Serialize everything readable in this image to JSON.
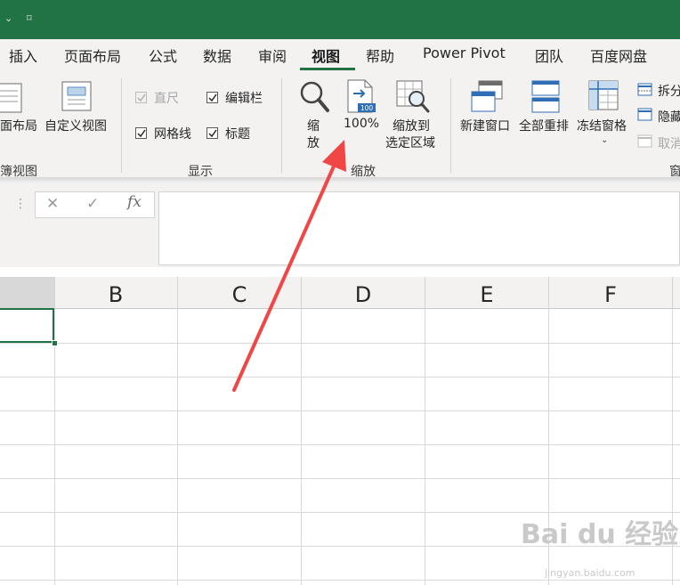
{
  "app": {
    "quick_access_glyph": "⌄",
    "quick_access_glyph2": "⌑"
  },
  "tabs": [
    {
      "label": "插入"
    },
    {
      "label": "页面布局"
    },
    {
      "label": "公式"
    },
    {
      "label": "数据"
    },
    {
      "label": "审阅"
    },
    {
      "label": "视图",
      "active": true
    },
    {
      "label": "帮助"
    },
    {
      "label": "Power Pivot"
    },
    {
      "label": "团队"
    },
    {
      "label": "百度网盘"
    }
  ],
  "ribbon": {
    "views_group": {
      "page_layout_label": "面布局",
      "custom_views_label": "自定义视图",
      "group_label": "簿视图"
    },
    "show_group": {
      "ruler_label": "直尺",
      "formula_bar_label": "编辑栏",
      "gridlines_label": "网格线",
      "headings_label": "标题",
      "group_label": "显示"
    },
    "zoom_group": {
      "zoom_label_1": "缩",
      "zoom_label_2": "放",
      "hundred_label": "100%",
      "hundred_icon_text": "100",
      "zoom_selection_label_1": "缩放到",
      "zoom_selection_label_2": "选定区域",
      "group_label": "缩放"
    },
    "window_group": {
      "new_window_label": "新建窗口",
      "arrange_all_label": "全部重排",
      "freeze_panes_label": "冻结窗格",
      "split_label": "拆分",
      "hide_label": "隐藏",
      "unhide_label": "取消",
      "group_label": "窗"
    }
  },
  "formula_bar": {
    "cancel": "✕",
    "enter": "✓",
    "fx": "fx",
    "value": ""
  },
  "sheet": {
    "columns": [
      "B",
      "C",
      "D",
      "E",
      "F"
    ]
  },
  "colors": {
    "accent": "#217346",
    "arrow": "#f04646"
  },
  "watermark": {
    "main": "Bai  du 经验",
    "sub": "jingyan.baidu.com"
  }
}
